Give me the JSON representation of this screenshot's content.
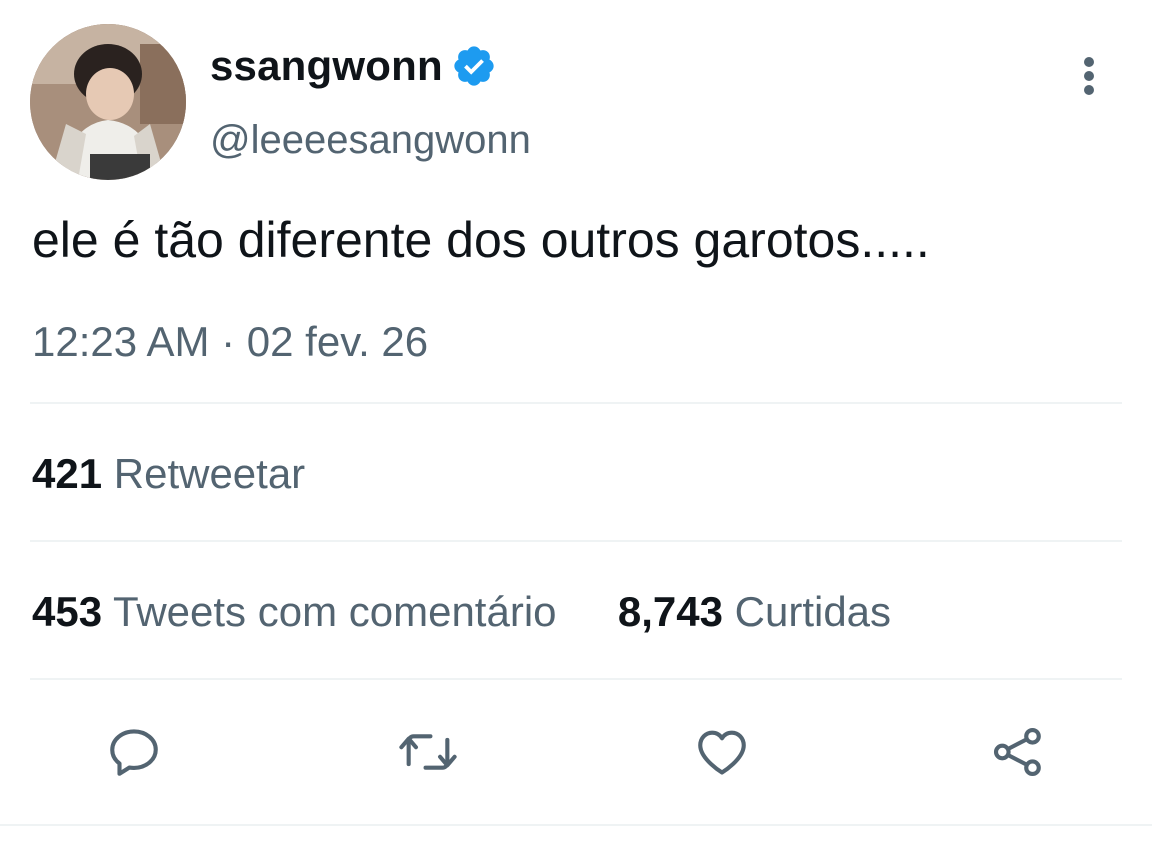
{
  "tweet": {
    "author": {
      "display_name": "ssangwonn",
      "handle": "@leeeesangwonn",
      "verified": true
    },
    "text": "ele é tão diferente dos outros garotos.....",
    "timestamp": "12:23 AM · 02 fev. 26"
  },
  "stats": {
    "retweets": {
      "count": "421",
      "label": "Retweetar"
    },
    "quotes": {
      "count": "453",
      "label": "Tweets com comentário"
    },
    "likes": {
      "count": "8,743",
      "label": "Curtidas"
    }
  },
  "actions": [
    {
      "icon": "reply-icon"
    },
    {
      "icon": "retweet-icon"
    },
    {
      "icon": "like-icon"
    },
    {
      "icon": "share-icon"
    }
  ],
  "colors": {
    "verified_blue": "#1d9bf0",
    "secondary_text": "#536471",
    "primary_text": "#0f1419",
    "divider": "#eff3f4",
    "icon_gray": "#536471"
  }
}
